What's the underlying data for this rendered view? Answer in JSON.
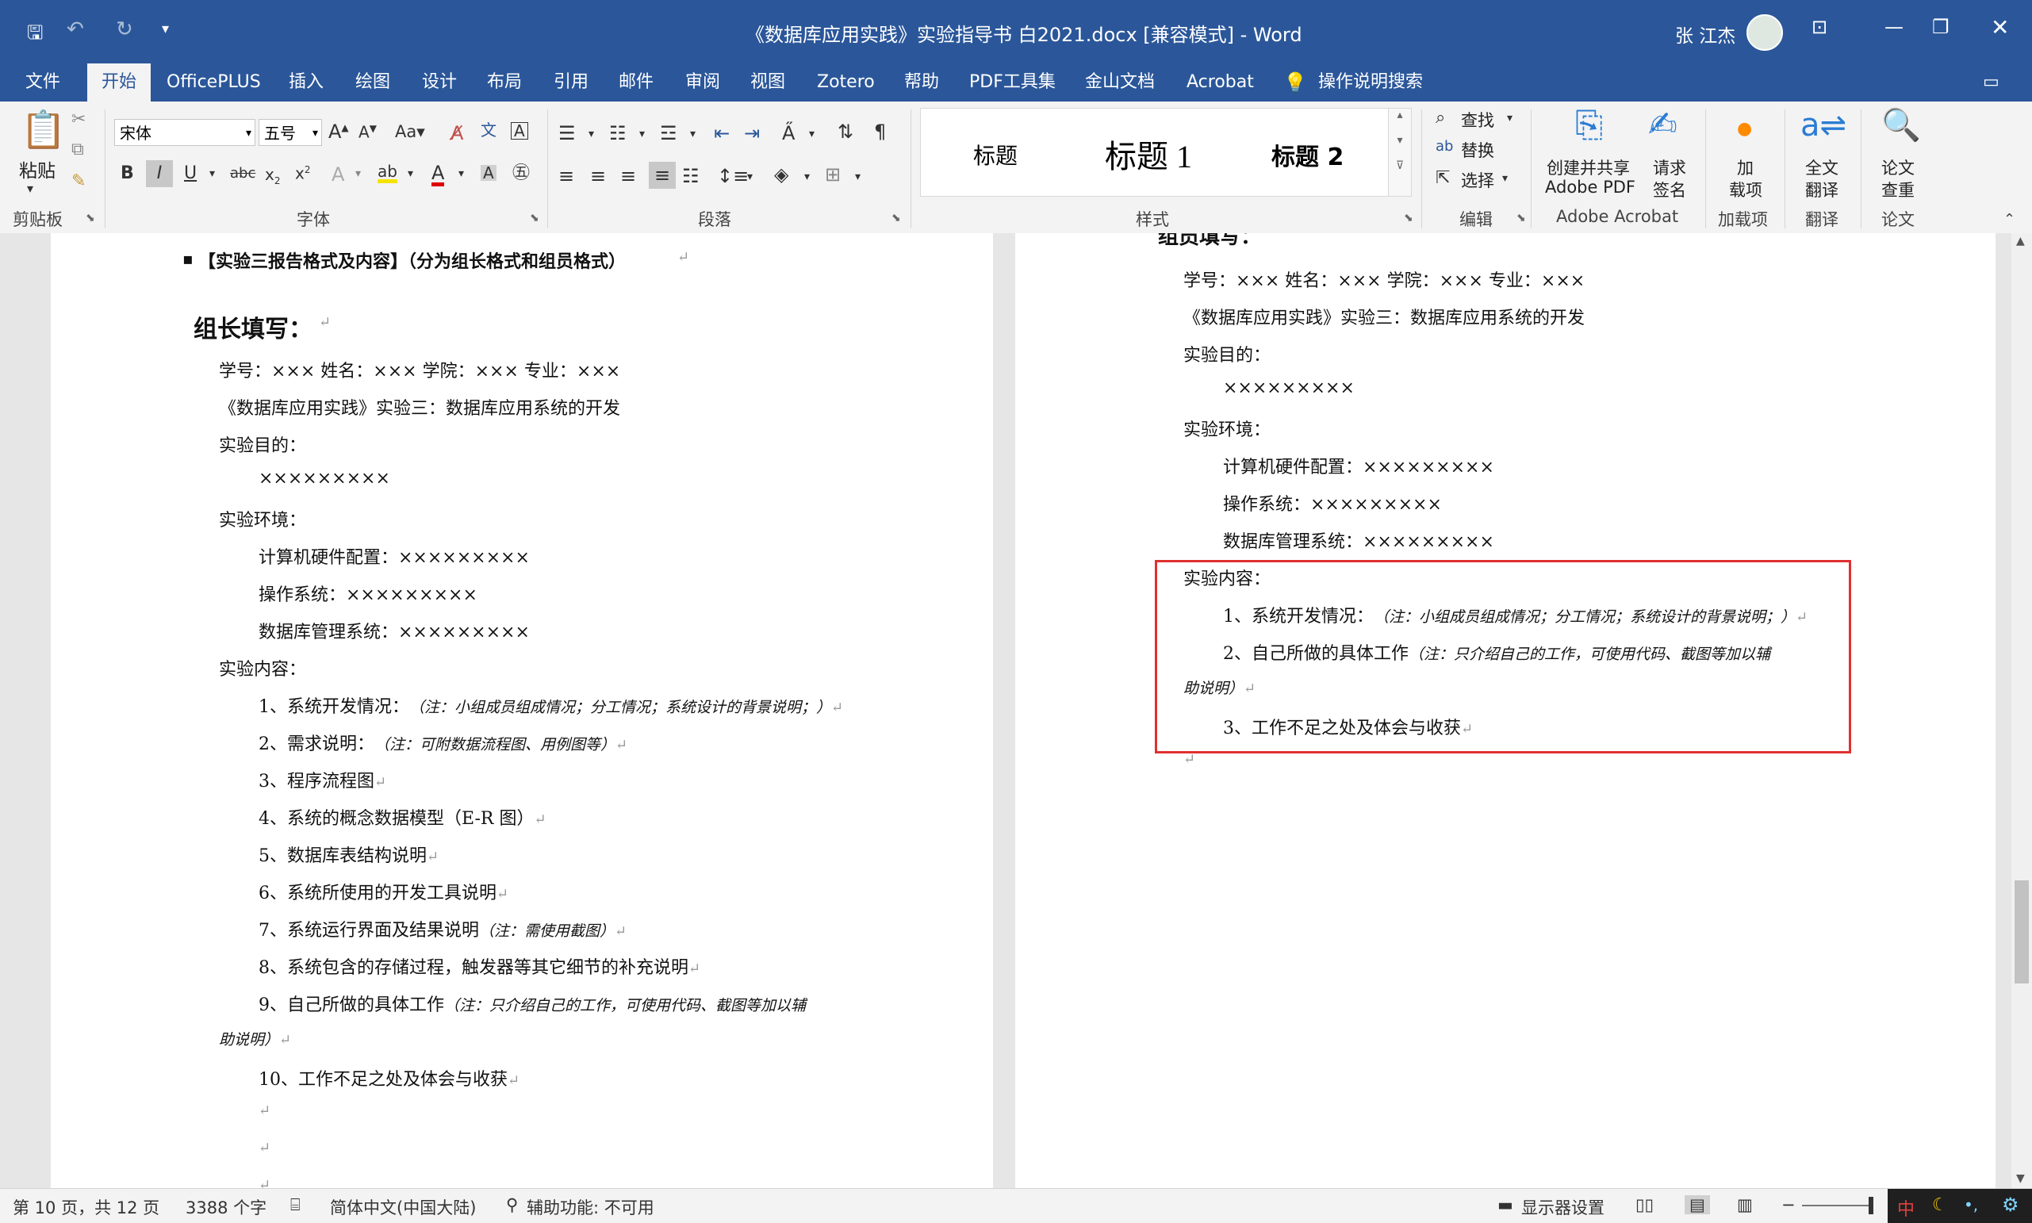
{
  "window": {
    "title": "《数据库应用实践》实验指导书 白2021.docx [兼容模式]  -  Word",
    "user": "张 江杰"
  },
  "tabs": [
    "文件",
    "开始",
    "OfficePLUS",
    "插入",
    "绘图",
    "设计",
    "布局",
    "引用",
    "邮件",
    "审阅",
    "视图",
    "Zotero",
    "帮助",
    "PDF工具集",
    "金山文档",
    "Acrobat",
    "操作说明搜索"
  ],
  "ribbon": {
    "paste": "粘贴",
    "clipboard": "剪贴板",
    "font_name": "宋体",
    "font_size": "五号",
    "font_group": "字体",
    "paragraph_group": "段落",
    "styles_group": "样式",
    "styles": [
      "标题",
      "标题 1",
      "标题 2"
    ],
    "find": "查找",
    "replace": "替换",
    "select": "选择",
    "edit_group": "编辑",
    "create_share_1": "创建并共享",
    "create_share_2": "Adobe PDF",
    "request_sign_1": "请求",
    "request_sign_2": "签名",
    "acrobat_group": "Adobe Acrobat",
    "addins_1": "加",
    "addins_2": "载项",
    "addins_group": "加载项",
    "translate_1": "全文",
    "translate_2": "翻译",
    "translate_group": "翻译",
    "paper_1": "论文",
    "paper_2": "查重",
    "paper_group": "论文"
  },
  "left_page": {
    "heading": "【实验三报告格式及内容】（分为组长格式和组员格式）",
    "leader": "组长填写：",
    "lines": [
      "学号：×××    姓名：×××   学院：×××   专业：×××",
      "《数据库应用实践》实验三：数据库应用系统的开发",
      "实验目的：",
      "×××××××××",
      "实验环境：",
      "计算机硬件配置：×××××××××",
      "操作系统：×××××××××",
      "数据库管理系统：×××××××××",
      "实验内容："
    ],
    "items": [
      {
        "text": "1、系统开发情况：",
        "note": "（注：小组成员组成情况；分工情况；系统设计的背景说明；）"
      },
      {
        "text": "2、需求说明：",
        "note": "（注：可附数据流程图、用例图等）"
      },
      {
        "text": "3、程序流程图",
        "note": ""
      },
      {
        "text": "4、系统的概念数据模型（E-R 图）",
        "note": ""
      },
      {
        "text": "5、数据库表结构说明",
        "note": ""
      },
      {
        "text": "6、系统所使用的开发工具说明",
        "note": ""
      },
      {
        "text": "7、系统运行界面及结果说明",
        "note": "（注：需使用截图）"
      },
      {
        "text": "8、系统包含的存储过程，触发器等其它细节的补充说明",
        "note": ""
      },
      {
        "text": "9、自己所做的具体工作",
        "note": "（注：只介绍自己的工作，可使用代码、截图等加以辅"
      },
      {
        "text": "",
        "note": "助说明）"
      },
      {
        "text": "10、工作不足之处及体会与收获",
        "note": ""
      }
    ]
  },
  "right_page": {
    "member": "组员填写：",
    "lines": [
      "学号：×××    姓名：×××   学院：×××   专业：×××",
      "《数据库应用实践》实验三：数据库应用系统的开发",
      "实验目的：",
      "×××××××××",
      "实验环境：",
      "计算机硬件配置：×××××××××",
      "操作系统：×××××××××",
      "数据库管理系统：×××××××××",
      "实验内容："
    ],
    "items": [
      {
        "text": "1、系统开发情况：",
        "note": "（注：小组成员组成情况；分工情况；系统设计的背景说明；）"
      },
      {
        "text": "2、自己所做的具体工作",
        "note": "（注：只介绍自己的工作，可使用代码、截图等加以辅"
      },
      {
        "text": "",
        "note": "助说明）"
      },
      {
        "text": "3、工作不足之处及体会与收获",
        "note": ""
      }
    ],
    "highlight_color": "#e03030"
  },
  "status": {
    "page": "第 10 页，共 12 页",
    "words": "3388 个字",
    "language": "简体中文(中国大陆)",
    "accessibility": "辅助功能: 不可用",
    "display": "显示器设置",
    "ime": "中"
  },
  "colors": {
    "accent": "#2b579a",
    "ribbon": "#f3f3f3"
  }
}
